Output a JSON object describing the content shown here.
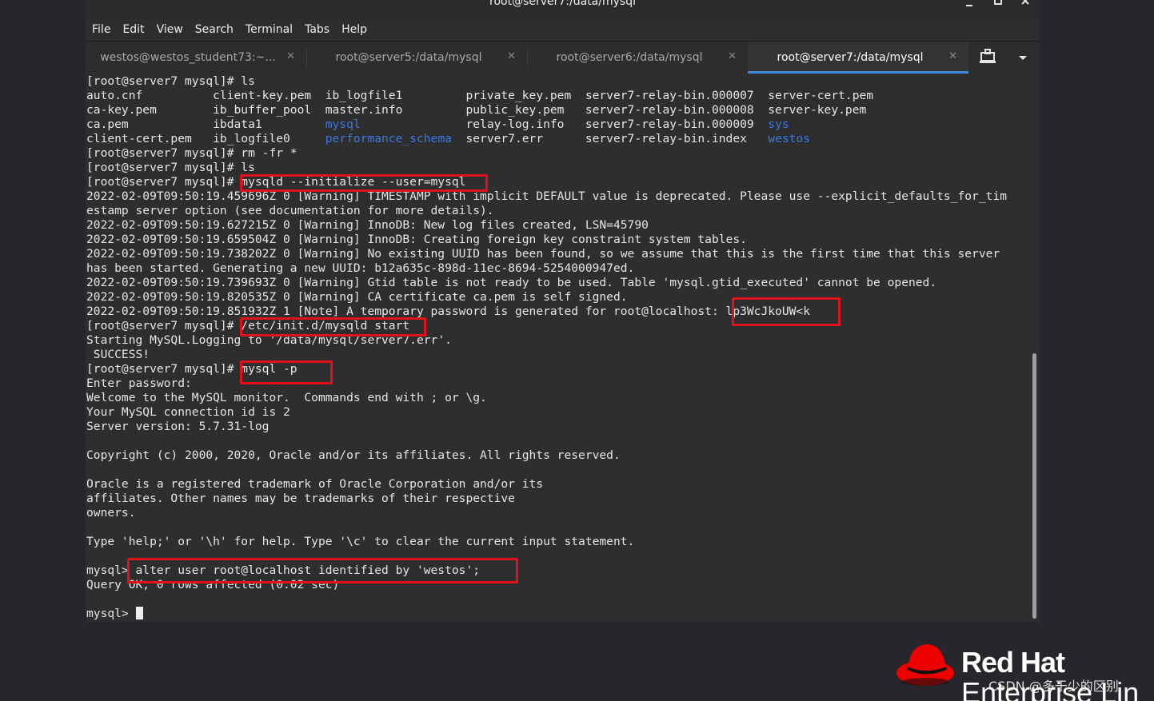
{
  "window": {
    "title": "root@server7:/data/mysql"
  },
  "menu": [
    "File",
    "Edit",
    "View",
    "Search",
    "Terminal",
    "Tabs",
    "Help"
  ],
  "tabs": [
    {
      "label": "westos@westos_student73:~...",
      "active": false
    },
    {
      "label": "root@server5:/data/mysql",
      "active": false
    },
    {
      "label": "root@server6:/data/mysql",
      "active": false
    },
    {
      "label": "root@server7:/data/mysql",
      "active": true
    }
  ],
  "icons": {
    "minimize": "minimize-icon",
    "maximize": "maximize-icon",
    "close": "close-icon",
    "tab_close": "close-icon",
    "new_tab": "new-tab-icon",
    "dropdown": "chevron-down-icon"
  },
  "colors": {
    "directory": "#3e76e2",
    "highlight": "#e0101c",
    "active_tab_indicator": "#3f8ae0"
  },
  "terminal": {
    "lines": [
      [
        {
          "t": "[root@server7 mysql]# ls"
        }
      ],
      [
        {
          "t": "auto.cnf          client-key.pem  ib_logfile1         private_key.pem  server7-relay-bin.000007  server-cert.pem"
        }
      ],
      [
        {
          "t": "ca-key.pem        ib_buffer_pool  master.info         public_key.pem   server7-relay-bin.000008  server-key.pem"
        }
      ],
      [
        {
          "t": "ca.pem            ibdata1         "
        },
        {
          "t": "mysql",
          "c": "dir"
        },
        {
          "t": "               relay-log.info   server7-relay-bin.000009  "
        },
        {
          "t": "sys",
          "c": "dir"
        }
      ],
      [
        {
          "t": "client-cert.pem   ib_logfile0     "
        },
        {
          "t": "performance_schema",
          "c": "dir"
        },
        {
          "t": "  server7.err      server7-relay-bin.index   "
        },
        {
          "t": "westos",
          "c": "dir"
        }
      ],
      [
        {
          "t": "[root@server7 mysql]# rm -fr *"
        }
      ],
      [
        {
          "t": "[root@server7 mysql]# ls"
        }
      ],
      [
        {
          "t": "[root@server7 mysql]# mysqld --initialize --user=mysql"
        }
      ],
      [
        {
          "t": "2022-02-09T09:50:19.459696Z 0 [Warning] TIMESTAMP with implicit DEFAULT value is deprecated. Please use --explicit_defaults_for_tim"
        }
      ],
      [
        {
          "t": "estamp server option (see documentation for more details)."
        }
      ],
      [
        {
          "t": "2022-02-09T09:50:19.627215Z 0 [Warning] InnoDB: New log files created, LSN=45790"
        }
      ],
      [
        {
          "t": "2022-02-09T09:50:19.659504Z 0 [Warning] InnoDB: Creating foreign key constraint system tables."
        }
      ],
      [
        {
          "t": "2022-02-09T09:50:19.738202Z 0 [Warning] No existing UUID has been found, so we assume that this is the first time that this server"
        }
      ],
      [
        {
          "t": "has been started. Generating a new UUID: b12a635c-898d-11ec-8694-5254000947ed."
        }
      ],
      [
        {
          "t": "2022-02-09T09:50:19.739693Z 0 [Warning] Gtid table is not ready to be used. Table 'mysql.gtid_executed' cannot be opened."
        }
      ],
      [
        {
          "t": "2022-02-09T09:50:19.820535Z 0 [Warning] CA certificate ca.pem is self signed."
        }
      ],
      [
        {
          "t": "2022-02-09T09:50:19.851932Z 1 [Note] A temporary password is generated for root@localhost: lp3WcJkoUW<k"
        }
      ],
      [
        {
          "t": "[root@server7 mysql]# /etc/init.d/mysqld start"
        }
      ],
      [
        {
          "t": "Starting MySQL.Logging to '/data/mysql/server7.err'."
        }
      ],
      [
        {
          "t": " SUCCESS!"
        }
      ],
      [
        {
          "t": "[root@server7 mysql]# mysql -p"
        }
      ],
      [
        {
          "t": "Enter password:"
        }
      ],
      [
        {
          "t": "Welcome to the MySQL monitor.  Commands end with ; or \\g."
        }
      ],
      [
        {
          "t": "Your MySQL connection id is 2"
        }
      ],
      [
        {
          "t": "Server version: 5.7.31-log"
        }
      ],
      [
        {
          "t": ""
        }
      ],
      [
        {
          "t": "Copyright (c) 2000, 2020, Oracle and/or its affiliates. All rights reserved."
        }
      ],
      [
        {
          "t": ""
        }
      ],
      [
        {
          "t": "Oracle is a registered trademark of Oracle Corporation and/or its"
        }
      ],
      [
        {
          "t": "affiliates. Other names may be trademarks of their respective"
        }
      ],
      [
        {
          "t": "owners."
        }
      ],
      [
        {
          "t": ""
        }
      ],
      [
        {
          "t": "Type 'help;' or '\\h' for help. Type '\\c' to clear the current input statement."
        }
      ],
      [
        {
          "t": ""
        }
      ],
      [
        {
          "t": "mysql> alter user root@localhost identified by 'westos';"
        }
      ],
      [
        {
          "t": "Query OK, 0 rows affected (0.02 sec)"
        }
      ],
      [
        {
          "t": ""
        }
      ],
      [
        {
          "t": "mysql> "
        }
      ]
    ]
  },
  "branding": {
    "name_line1": "Red Hat",
    "name_line2": "Enterprise Lin",
    "watermark": "CSDN @多于少的区别"
  }
}
